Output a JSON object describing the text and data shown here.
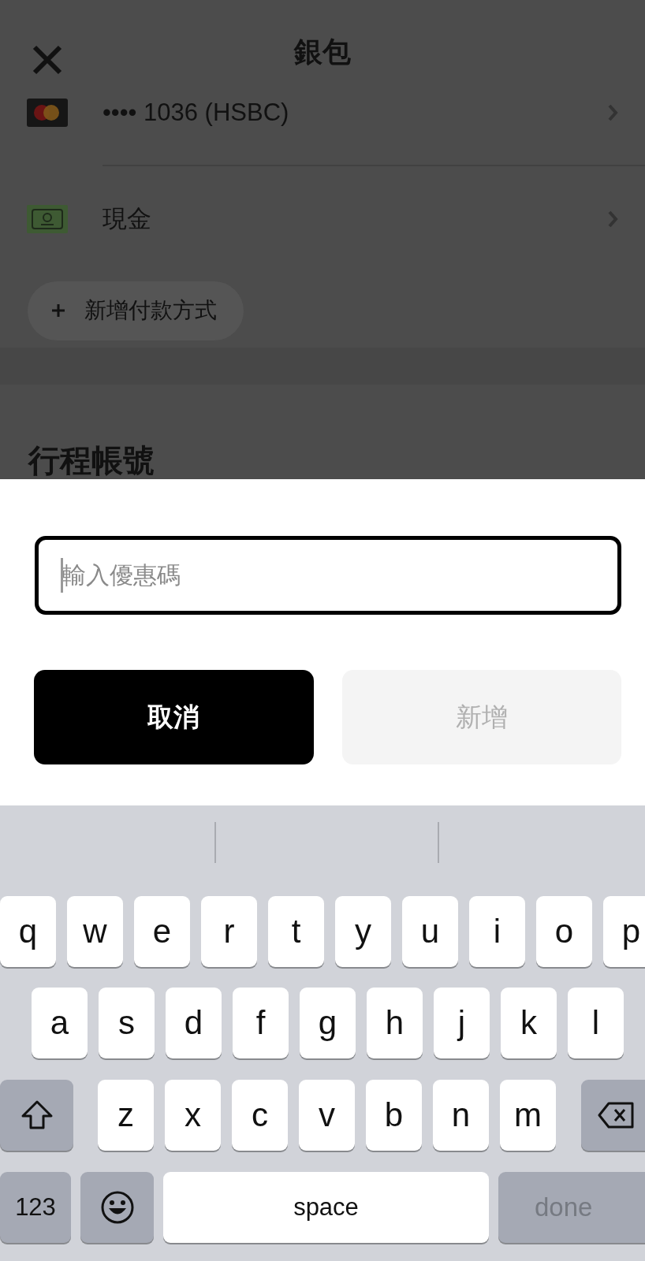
{
  "header": {
    "title": "銀包"
  },
  "payment_methods": [
    {
      "kind": "card",
      "label": "•••• 1036 (HSBC)"
    },
    {
      "kind": "cash",
      "label": "現金"
    }
  ],
  "add_payment_button": {
    "label": "新增付款方式"
  },
  "section_heading": "行程帳號",
  "promo_sheet": {
    "field": {
      "placeholder": "輸入優惠碼"
    },
    "buttons": [
      {
        "kind": "primary",
        "label": "取消",
        "disabled": false
      },
      {
        "kind": "secondary",
        "label": "新增",
        "disabled": true
      }
    ]
  },
  "keyboard": {
    "rows": [
      {
        "keys": [
          {
            "kind": "letter",
            "label": "q"
          },
          {
            "kind": "letter",
            "label": "w"
          },
          {
            "kind": "letter",
            "label": "e"
          },
          {
            "kind": "letter",
            "label": "r"
          },
          {
            "kind": "letter",
            "label": "t"
          },
          {
            "kind": "letter",
            "label": "y"
          },
          {
            "kind": "letter",
            "label": "u"
          },
          {
            "kind": "letter",
            "label": "i"
          },
          {
            "kind": "letter",
            "label": "o"
          },
          {
            "kind": "letter",
            "label": "p"
          }
        ]
      },
      {
        "keys": [
          {
            "kind": "letter",
            "label": "a"
          },
          {
            "kind": "letter",
            "label": "s"
          },
          {
            "kind": "letter",
            "label": "d"
          },
          {
            "kind": "letter",
            "label": "f"
          },
          {
            "kind": "letter",
            "label": "g"
          },
          {
            "kind": "letter",
            "label": "h"
          },
          {
            "kind": "letter",
            "label": "j"
          },
          {
            "kind": "letter",
            "label": "k"
          },
          {
            "kind": "letter",
            "label": "l"
          }
        ]
      },
      {
        "keys": [
          {
            "kind": "shift"
          },
          {
            "kind": "letter",
            "label": "z"
          },
          {
            "kind": "letter",
            "label": "x"
          },
          {
            "kind": "letter",
            "label": "c"
          },
          {
            "kind": "letter",
            "label": "v"
          },
          {
            "kind": "letter",
            "label": "b"
          },
          {
            "kind": "letter",
            "label": "n"
          },
          {
            "kind": "letter",
            "label": "m"
          },
          {
            "kind": "backspace"
          }
        ]
      },
      {
        "keys": [
          {
            "kind": "numbers",
            "label": "123"
          },
          {
            "kind": "emoji"
          },
          {
            "kind": "space",
            "label": "space"
          },
          {
            "kind": "done",
            "label": "done",
            "disabled": true
          }
        ]
      }
    ]
  }
}
